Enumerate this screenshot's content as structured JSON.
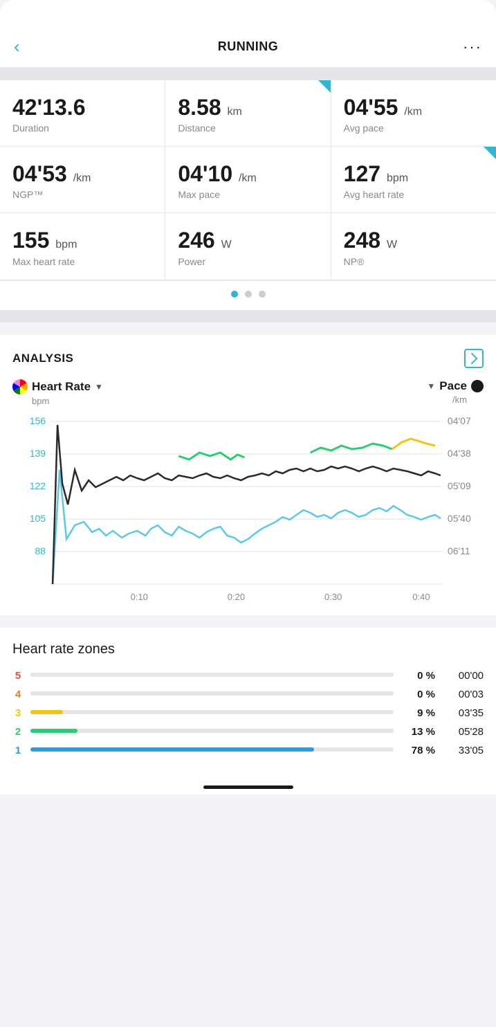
{
  "header": {
    "title": "RUNNING",
    "back_label": "‹",
    "more_label": "···"
  },
  "stats": {
    "rows": [
      [
        {
          "value": "42'13.6",
          "unit": "",
          "label": "Duration"
        },
        {
          "value": "8.58",
          "unit": " km",
          "label": "Distance",
          "indicator": true
        },
        {
          "value": "04'55",
          "unit": " /km",
          "label": "Avg pace"
        }
      ],
      [
        {
          "value": "04'53",
          "unit": " /km",
          "label": "NGP™"
        },
        {
          "value": "04'10",
          "unit": " /km",
          "label": "Max pace"
        },
        {
          "value": "127",
          "unit": " bpm",
          "label": "Avg heart rate",
          "indicator": true
        }
      ],
      [
        {
          "value": "155",
          "unit": " bpm",
          "label": "Max heart rate"
        },
        {
          "value": "246",
          "unit": " W",
          "label": "Power"
        },
        {
          "value": "248",
          "unit": " W",
          "label": "NP®"
        }
      ]
    ]
  },
  "pagination": {
    "dots": [
      {
        "active": true
      },
      {
        "active": false
      },
      {
        "active": false
      }
    ]
  },
  "analysis": {
    "title": "ANALYSIS",
    "left_metric": {
      "name": "Heart Rate",
      "unit": "bpm"
    },
    "right_metric": {
      "name": "Pace",
      "unit": "/km"
    },
    "chart": {
      "y_labels_left": [
        "156",
        "139",
        "122",
        "105",
        "88"
      ],
      "y_labels_right": [
        "04'07",
        "04'38",
        "05'09",
        "05'40",
        "06'11"
      ],
      "x_labels": [
        "0:10",
        "0:20",
        "0:30",
        "0:40"
      ]
    }
  },
  "hr_zones": {
    "title": "Heart rate zones",
    "zones": [
      {
        "number": "5",
        "color": "#e74c3c",
        "percent": "0 %",
        "time": "00'00",
        "fill_pct": 0
      },
      {
        "number": "4",
        "color": "#e67e22",
        "percent": "0 %",
        "time": "00'03",
        "fill_pct": 0
      },
      {
        "number": "3",
        "color": "#f1c40f",
        "percent": "9 %",
        "time": "03'35",
        "fill_pct": 9
      },
      {
        "number": "2",
        "color": "#2ecc71",
        "percent": "13 %",
        "time": "05'28",
        "fill_pct": 13
      },
      {
        "number": "1",
        "color": "#3498db",
        "percent": "78 %",
        "time": "33'05",
        "fill_pct": 78
      }
    ]
  }
}
